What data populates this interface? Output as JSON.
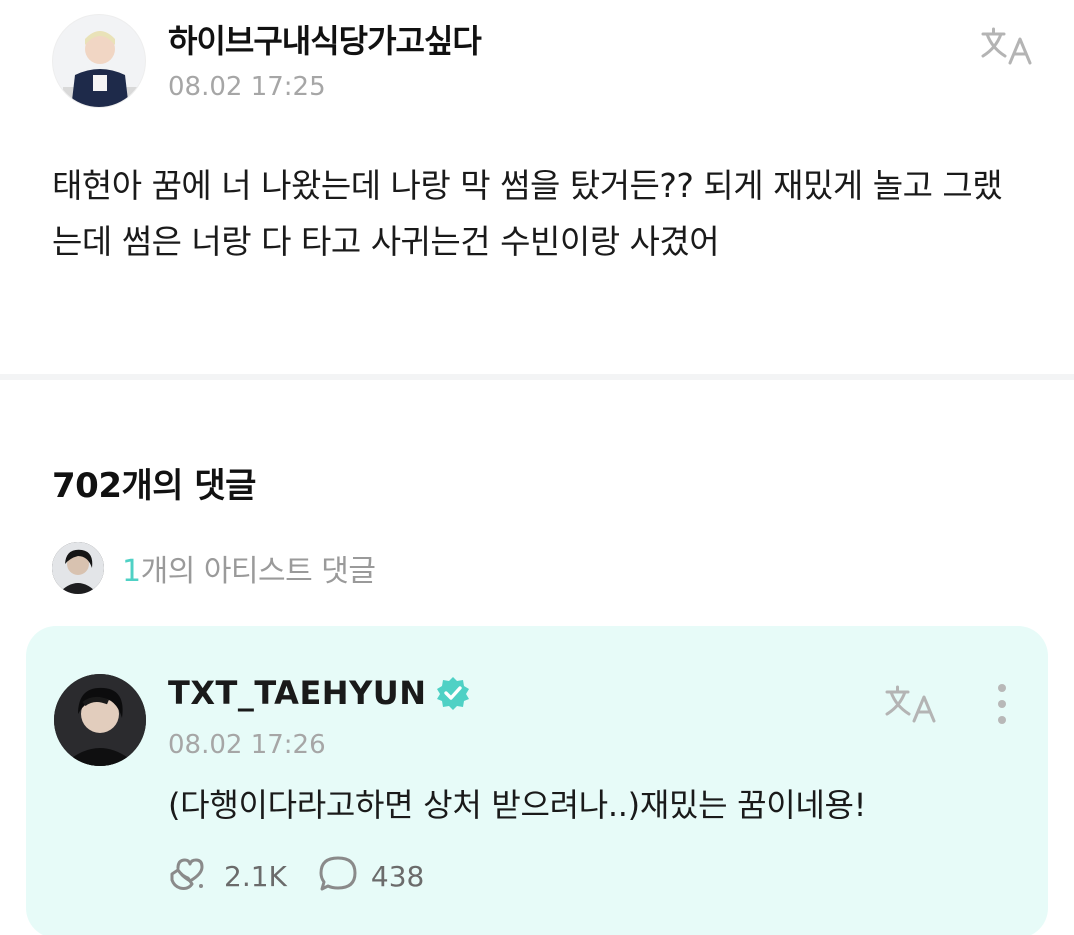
{
  "post": {
    "author": "하이브구내식당가고싶다",
    "timestamp": "08.02 17:25",
    "body": "태현아 꿈에 너 나왔는데 나랑 막 썸을 탔거든?? 되게 재밌게 놀고 그랬는데 썸은 너랑 다 타고 사귀는건 수빈이랑 사겼어",
    "translate_icon": "translate-icon"
  },
  "comments": {
    "count_label": "702개의 댓글",
    "artist_summary": {
      "count": "1",
      "label": "개의 아티스트 댓글"
    },
    "artist_comment": {
      "author": "TXT_TAEHYUN",
      "timestamp": "08.02 17:26",
      "text": "(다행이다라고하면 상처 받으려나..)재밌는 꿈이네용!",
      "likes": "2.1K",
      "replies": "438",
      "verified_icon": "verified-badge-icon",
      "like_icon": "heart-hand-icon",
      "reply_icon": "speech-bubble-icon",
      "more_icon": "more-vertical-icon"
    }
  },
  "colors": {
    "accent": "#4fd1c5",
    "card_background": "#e7fbf8",
    "meta_text": "#a6a6a6"
  }
}
